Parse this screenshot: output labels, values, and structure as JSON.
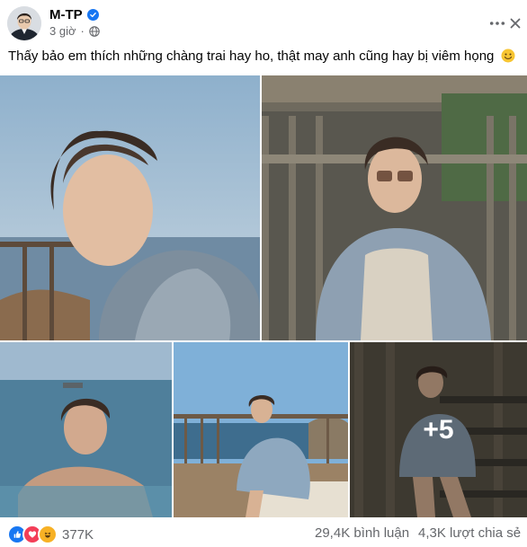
{
  "post": {
    "author": "M-TP",
    "time": "3 giờ",
    "separator": "·",
    "caption": "Thấy bảo em thích những chàng trai hay ho, thật may anh cũng hay bị viêm họng",
    "more_photos": "+5"
  },
  "footer": {
    "reaction_count": "377K",
    "comments": "29,4K bình luận",
    "shares": "4,3K lượt chia sẻ"
  },
  "colors": {
    "verified": "#1877f2",
    "like": "#1877f2",
    "love": "#f33e58",
    "haha": "#f7b125",
    "meta_text": "#65676b"
  },
  "icons": [
    "verified-badge-icon",
    "globe-icon",
    "more-options-icon",
    "close-icon",
    "smiley-emoji-icon",
    "like-reaction-icon",
    "love-reaction-icon",
    "haha-reaction-icon"
  ]
}
